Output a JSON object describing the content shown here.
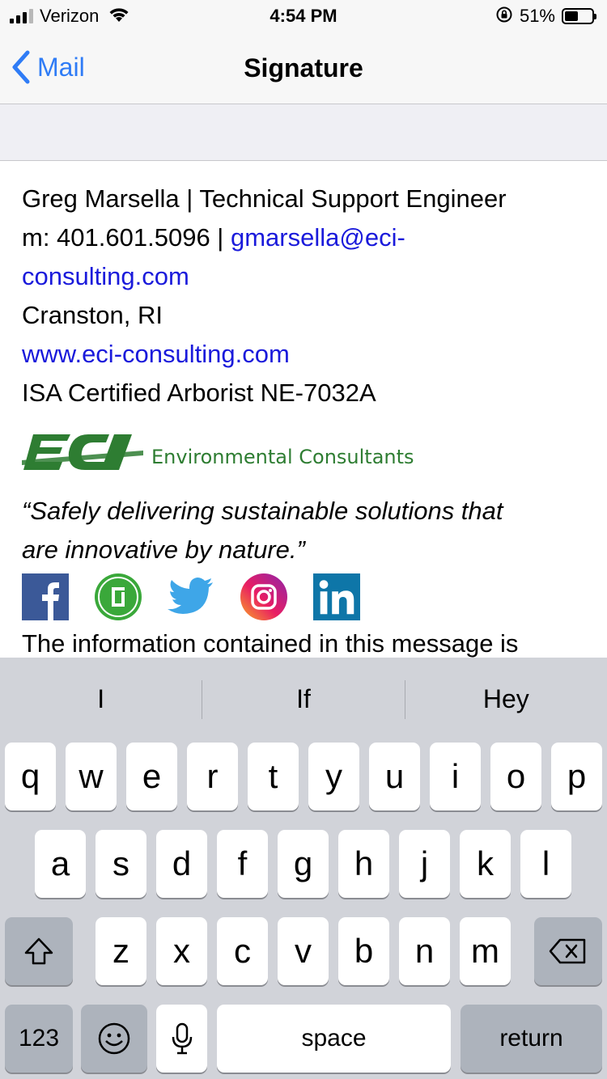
{
  "status_bar": {
    "carrier": "Verizon",
    "time": "4:54 PM",
    "battery_percent": "51%",
    "battery_level": 0.51,
    "signal_bars": 3
  },
  "nav": {
    "back_label": "Mail",
    "title": "Signature"
  },
  "signature": {
    "name_line": "Greg Marsella | Technical Support Engineer",
    "phone_prefix": "m: 401.601.5096 | ",
    "email_part1": "gmarsella@eci-",
    "email_part2": "consulting.com",
    "location": "Cranston, RI",
    "website": "www.eci-consulting.com",
    "certification": "ISA Certified Arborist NE-7032A",
    "logo_letters": "ECI",
    "logo_text": "Environmental Consultants",
    "tagline_line1": "“Safely delivering sustainable solutions that",
    "tagline_line2": "are innovative by nature.”",
    "social_icons": [
      "facebook-icon",
      "glassdoor-icon",
      "twitter-icon",
      "instagram-icon",
      "linkedin-icon"
    ],
    "disclaimer": "The information contained in this message is"
  },
  "keyboard": {
    "predictions": [
      "I",
      "If",
      "Hey"
    ],
    "row1": [
      "q",
      "w",
      "e",
      "r",
      "t",
      "y",
      "u",
      "i",
      "o",
      "p"
    ],
    "row2": [
      "a",
      "s",
      "d",
      "f",
      "g",
      "h",
      "j",
      "k",
      "l"
    ],
    "row3": [
      "z",
      "x",
      "c",
      "v",
      "b",
      "n",
      "m"
    ],
    "numbers_label": "123",
    "space_label": "space",
    "return_label": "return"
  },
  "colors": {
    "link": "#1a1adb",
    "ios_blue": "#2f7cf6",
    "eci_green": "#2e7d32",
    "keyboard_bg": "#d1d3d9"
  }
}
